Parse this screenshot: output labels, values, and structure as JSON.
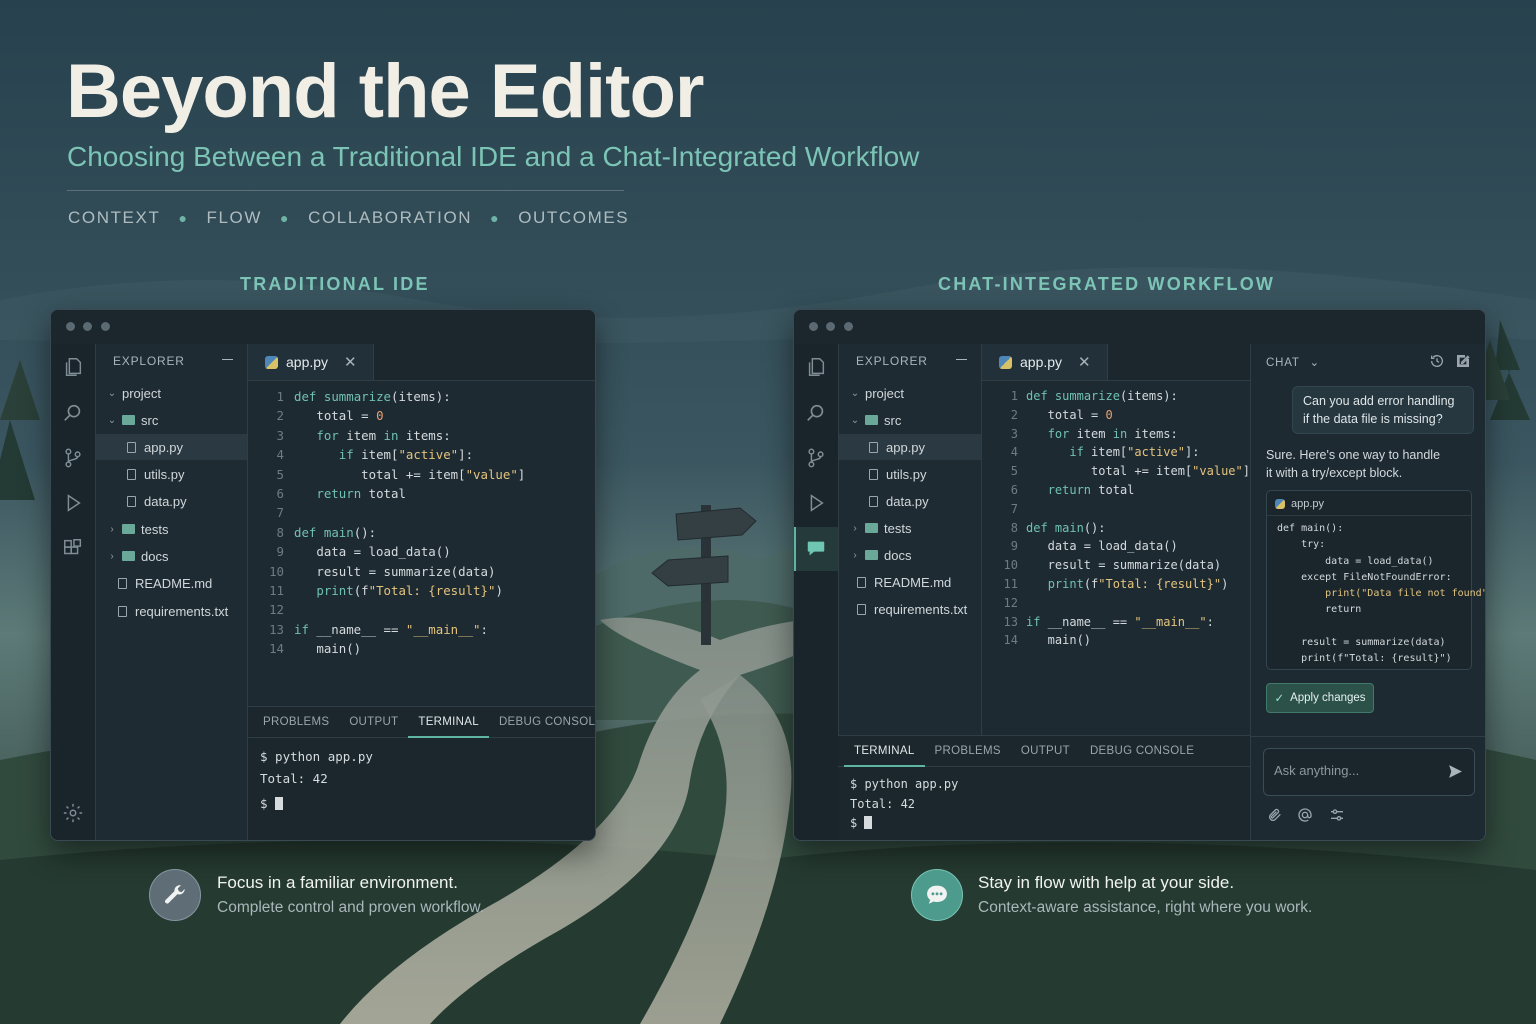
{
  "header": {
    "title": "Beyond the Editor",
    "subtitle": "Choosing Between a Traditional IDE and a Chat-Integrated Workflow",
    "topics": [
      "CONTEXT",
      "FLOW",
      "COLLABORATION",
      "OUTCOMES"
    ]
  },
  "sections": {
    "left_label": "TRADITIONAL IDE",
    "right_label": "CHAT-INTEGRATED WORKFLOW"
  },
  "explorer": {
    "header": "EXPLORER",
    "root": "project",
    "src": "src",
    "files_src": [
      "app.py",
      "utils.py",
      "data.py"
    ],
    "tests": "tests",
    "docs": "docs",
    "readme": "README.md",
    "requirements": "requirements.txt"
  },
  "editor": {
    "tab_label": "app.py",
    "line_numbers": [
      "1",
      "2",
      "3",
      "4",
      "5",
      "6",
      "7",
      "8",
      "9",
      "10",
      "11",
      "12",
      "13",
      "14"
    ]
  },
  "left_panel": {
    "tabs": [
      "PROBLEMS",
      "OUTPUT",
      "TERMINAL",
      "DEBUG CONSOLE"
    ],
    "active_tab": "TERMINAL",
    "terminal": [
      "$ python app.py",
      "Total: 42",
      "$"
    ]
  },
  "right_panel": {
    "tabs": [
      "TERMINAL",
      "PROBLEMS",
      "OUTPUT",
      "DEBUG CONSOLE"
    ],
    "active_tab": "TERMINAL",
    "terminal": [
      "$ python app.py",
      "Total: 42",
      "$"
    ]
  },
  "chat": {
    "header": "CHAT",
    "user_message_line1": "Can you add error handling",
    "user_message_line2": "if the data file is missing?",
    "reply_line1": "Sure. Here's one way to handle",
    "reply_line2": "it with a try/except block.",
    "snippet_file": "app.py",
    "snippet_lines": [
      "def main():",
      "    try:",
      "        data = load_data()",
      "    except FileNotFoundError:",
      "        print(\"Data file not found\")",
      "        return",
      "",
      "    result = summarize(data)",
      "    print(f\"Total: {result}\")"
    ],
    "apply_label": "Apply changes",
    "input_placeholder": "Ask anything..."
  },
  "features": {
    "left_title": "Focus in a familiar environment.",
    "left_subtitle": "Complete control and proven workflow.",
    "right_title": "Stay in flow with help at your side.",
    "right_subtitle": "Context-aware assistance, right where you work."
  },
  "colors": {
    "accent": "#7cc4b6",
    "title": "#f1eee6",
    "window_bg": "#1e2a32"
  },
  "icons": [
    "files-icon",
    "search-icon",
    "source-control-icon",
    "run-debug-icon",
    "extensions-icon",
    "chat-icon",
    "settings-icon",
    "history-icon",
    "new-chat-icon",
    "chevron-down-icon",
    "send-icon",
    "attach-icon",
    "mention-icon",
    "options-icon",
    "wrench-icon",
    "chat-bubble-icon",
    "check-icon"
  ]
}
